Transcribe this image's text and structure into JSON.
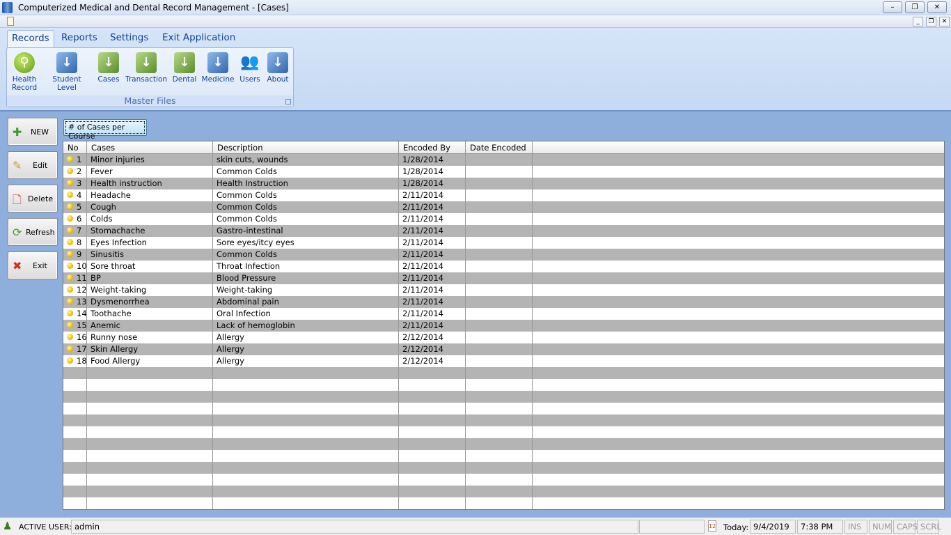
{
  "window": {
    "title": "Computerized Medical and Dental Record Management - [Cases]"
  },
  "tabs": [
    {
      "label": "Records",
      "active": true
    },
    {
      "label": "Reports"
    },
    {
      "label": "Settings"
    },
    {
      "label": "Exit Application"
    }
  ],
  "ribbon": {
    "group_label": "Master Files",
    "items": [
      {
        "label": "Health Record",
        "icon": "magnifier-icon"
      },
      {
        "label": "Student Level",
        "icon": "blue-cube-icon"
      },
      {
        "label": "Cases",
        "icon": "green-cube-icon"
      },
      {
        "label": "Transaction",
        "icon": "green-cube-icon"
      },
      {
        "label": "Dental",
        "icon": "green-cube-icon"
      },
      {
        "label": "Medicine",
        "icon": "blue-cube-icon"
      },
      {
        "label": "Users",
        "icon": "users-icon"
      },
      {
        "label": "About",
        "icon": "blue-cube-icon"
      }
    ]
  },
  "side_buttons": [
    {
      "label": "NEW",
      "icon": "plus-icon"
    },
    {
      "label": "Edit",
      "icon": "edit-icon"
    },
    {
      "label": "Delete",
      "icon": "delete-icon"
    },
    {
      "label": "Refresh",
      "icon": "refresh-icon"
    },
    {
      "label": "Exit",
      "icon": "x-icon"
    }
  ],
  "report_button": "# of Cases per Course",
  "grid": {
    "columns": [
      "No",
      "Cases",
      "Description",
      "Encoded By",
      "Date Encoded"
    ],
    "rows": [
      [
        "1",
        "Minor injuries",
        "skin cuts, wounds",
        "1/28/2014",
        ""
      ],
      [
        "2",
        "Fever",
        "Common Colds",
        "1/28/2014",
        ""
      ],
      [
        "3",
        "Health instruction",
        "Health Instruction",
        "1/28/2014",
        ""
      ],
      [
        "4",
        "Headache",
        "Common Colds",
        "2/11/2014",
        ""
      ],
      [
        "5",
        "Cough",
        "Common Colds",
        "2/11/2014",
        ""
      ],
      [
        "6",
        "Colds",
        "Common Colds",
        "2/11/2014",
        ""
      ],
      [
        "7",
        "Stomachache",
        "Gastro-intestinal",
        "2/11/2014",
        ""
      ],
      [
        "8",
        "Eyes Infection",
        "Sore eyes/itcy eyes",
        "2/11/2014",
        ""
      ],
      [
        "9",
        "Sinusitis",
        "Common Colds",
        "2/11/2014",
        ""
      ],
      [
        "10",
        "Sore throat",
        "Throat Infection",
        "2/11/2014",
        ""
      ],
      [
        "11",
        "BP",
        "Blood Pressure",
        "2/11/2014",
        ""
      ],
      [
        "12",
        "Weight-taking",
        "Weight-taking",
        "2/11/2014",
        ""
      ],
      [
        "13",
        "Dysmenorrhea",
        "Abdominal pain",
        "2/11/2014",
        ""
      ],
      [
        "14",
        "Toothache",
        "Oral Infection",
        "2/11/2014",
        ""
      ],
      [
        "15",
        "Anemic",
        "Lack of hemoglobin",
        "2/11/2014",
        ""
      ],
      [
        "16",
        "Runny nose",
        "Allergy",
        "2/12/2014",
        ""
      ],
      [
        "17",
        "Skin Allergy",
        "Allergy",
        "2/12/2014",
        ""
      ],
      [
        "18",
        "Food Allergy",
        "Allergy",
        "2/12/2014",
        ""
      ]
    ]
  },
  "status": {
    "active_user_label": "ACTIVE USER:",
    "active_user": "admin",
    "today_label": "Today:",
    "date": "9/4/2019",
    "time": "7:38 PM",
    "ins": "INS",
    "num": "NUM",
    "caps": "CAPS",
    "scrl": "SCRL"
  }
}
